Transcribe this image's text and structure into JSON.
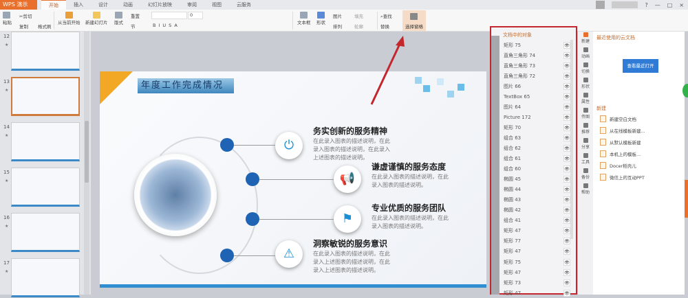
{
  "app": {
    "name": "WPS 演示"
  },
  "tabs": [
    "开始",
    "插入",
    "设计",
    "动画",
    "幻灯片放映",
    "审阅",
    "视图",
    "云服务"
  ],
  "window_controls": [
    "?",
    "—",
    "□",
    "×"
  ],
  "ribbon": {
    "paste": "粘贴",
    "cut": "剪切",
    "copy": "复制",
    "format_painter": "格式刷",
    "from_current": "从当前开始",
    "new_slide": "新建幻灯片",
    "layout": "版式",
    "reset": "重置",
    "section": "节",
    "font_size": "0",
    "text_box": "文本框",
    "shape": "形状",
    "picture": "图片",
    "fill": "填充",
    "arrange": "排列",
    "outline": "轮廓",
    "find": "查找",
    "replace": "替换",
    "selection_pane": "选择窗格"
  },
  "thumbnails": [
    {
      "num": "12",
      "top": true
    },
    {
      "num": "13",
      "selected": true
    },
    {
      "num": "14"
    },
    {
      "num": "15"
    },
    {
      "num": "16"
    },
    {
      "num": "17"
    }
  ],
  "slide": {
    "title": "年度工作完成情况",
    "items": [
      {
        "title": "务实创新的服务精神",
        "desc": "在此录入图表的描述说明，在此录入图表的描述说明，在此录入上述图表的描述说明。",
        "icon": "⏻"
      },
      {
        "title": "谦虚谨慎的服务态度",
        "desc": "在此录入图表的描述说明，在此录入图表的描述说明。",
        "icon": "📢"
      },
      {
        "title": "专业优质的服务团队",
        "desc": "在此录入图表的描述说明，在此录入图表的描述说明。",
        "icon": "⚑"
      },
      {
        "title": "洞察敏锐的服务意识",
        "desc": "在此录入图表的描述说明，在此录入上述图表的描述说明，在此录入上述图表的描述说明。",
        "icon": "⚠"
      }
    ]
  },
  "selection_pane": {
    "header": "文档中的对象",
    "items": [
      "矩形 75",
      "直角三角形 74",
      "直角三角形 73",
      "直角三角形 72",
      "图片 66",
      "TextBox 65",
      "图片 64",
      "Picture 172",
      "矩形 70",
      "组合 63",
      "组合 62",
      "组合 61",
      "组合 60",
      "椭圆 45",
      "椭圆 44",
      "椭圆 43",
      "椭圆 42",
      "组合 41",
      "矩形 47",
      "矩形 77",
      "矩形 47",
      "矩形 75",
      "矩形 47",
      "矩形 73",
      "矩形 47"
    ]
  },
  "side_tabs": [
    "新建",
    "动画",
    "切换",
    "形状",
    "属性",
    "传图",
    "推荐",
    "分享",
    "工具",
    "备份",
    "帮助"
  ],
  "right_panel": {
    "recent_title": "最近使用的云文档",
    "open_recent": "查看最近打开",
    "new_title": "新建",
    "new_items": [
      "新建空白文档",
      "从在线模板新建...",
      "从默认模板新建",
      "本机上的模板...",
      "Docer稻壳儿",
      "微信上的互动PPT"
    ]
  }
}
